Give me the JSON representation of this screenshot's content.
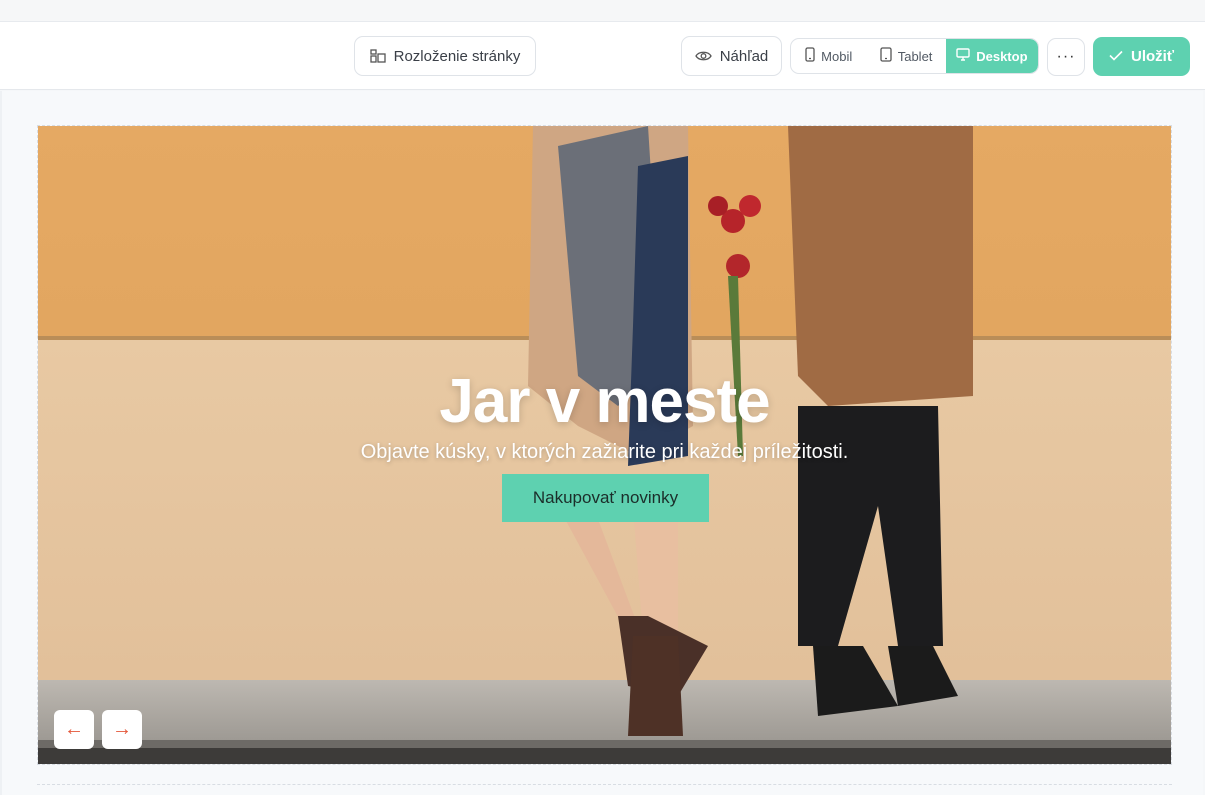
{
  "toolbar": {
    "layout_label": "Rozloženie stránky",
    "preview_label": "Náhľad",
    "devices": [
      {
        "label": "Mobil",
        "icon": "phone-icon",
        "active": false
      },
      {
        "label": "Tablet",
        "icon": "tablet-icon",
        "active": false
      },
      {
        "label": "Desktop",
        "icon": "monitor-icon",
        "active": true
      }
    ],
    "more_label": "···",
    "save_label": "Uložiť",
    "accent_color": "#5ed1b0"
  },
  "hero": {
    "title": "Jar v meste",
    "subtitle": "Objavte kúsky, v ktorých zažiarite pri každej príležitosti.",
    "cta_label": "Nakupovať novinky",
    "prev_arrow": "←",
    "next_arrow": "→",
    "arrow_color": "#e4573a"
  }
}
